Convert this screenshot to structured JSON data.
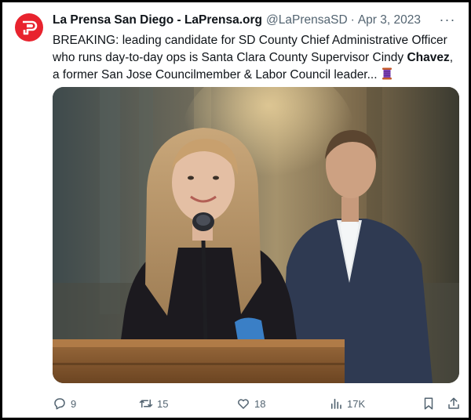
{
  "tweet": {
    "author_name": "La Prensa San Diego - LaPrensa.org",
    "handle": "@LaPrensaSD",
    "separator": "·",
    "date": "Apr 3, 2023",
    "text_part1": "BREAKING: leading candidate for SD County Chief Administrative Officer who runs day-to-day ops is Santa Clara County Supervisor Cindy ",
    "text_bold": "Chavez",
    "text_part2": ", a former San Jose Councilmember & Labor Council leader...",
    "more_label": "···"
  },
  "actions": {
    "replies": "9",
    "retweets": "15",
    "likes": "18",
    "views": "17K"
  },
  "colors": {
    "brand_red": "#e8232e",
    "muted": "#536471",
    "text": "#0f1419"
  }
}
